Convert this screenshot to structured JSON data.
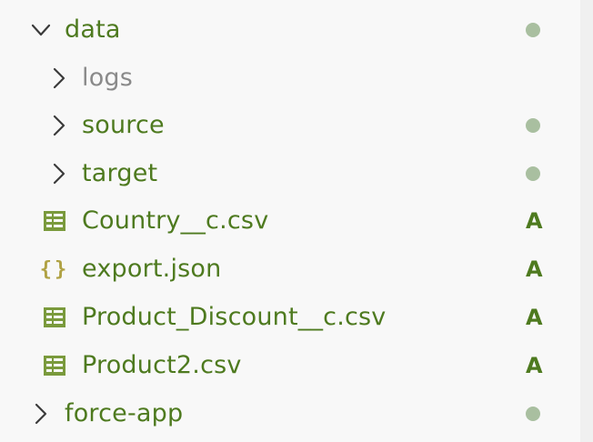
{
  "colors": {
    "added": "#4e7a1f",
    "ignored": "#8a8a8a",
    "twisty": "#3b3b3b",
    "dot": "#a9bfa0",
    "csv_icon": "#7a9a3c",
    "json_icon": "#b0a244"
  },
  "tree": {
    "data_folder": {
      "label": "data",
      "icon": "chevron-down-icon",
      "decoration": "modified-dot"
    },
    "logs_folder": {
      "label": "logs",
      "icon": "chevron-right-icon"
    },
    "source_folder": {
      "label": "source",
      "icon": "chevron-right-icon",
      "decoration": "modified-dot"
    },
    "target_folder": {
      "label": "target",
      "icon": "chevron-right-icon",
      "decoration": "modified-dot"
    },
    "country_file": {
      "label": "Country__c.csv",
      "icon": "csv-table-icon",
      "badge": "A"
    },
    "export_file": {
      "label": "export.json",
      "icon": "json-braces-icon",
      "badge": "A"
    },
    "product_discount_file": {
      "label": "Product_Discount__c.csv",
      "icon": "csv-table-icon",
      "badge": "A"
    },
    "product2_file": {
      "label": "Product2.csv",
      "icon": "csv-table-icon",
      "badge": "A"
    },
    "force_app_folder": {
      "label": "force-app",
      "icon": "chevron-right-icon",
      "decoration": "modified-dot"
    }
  }
}
